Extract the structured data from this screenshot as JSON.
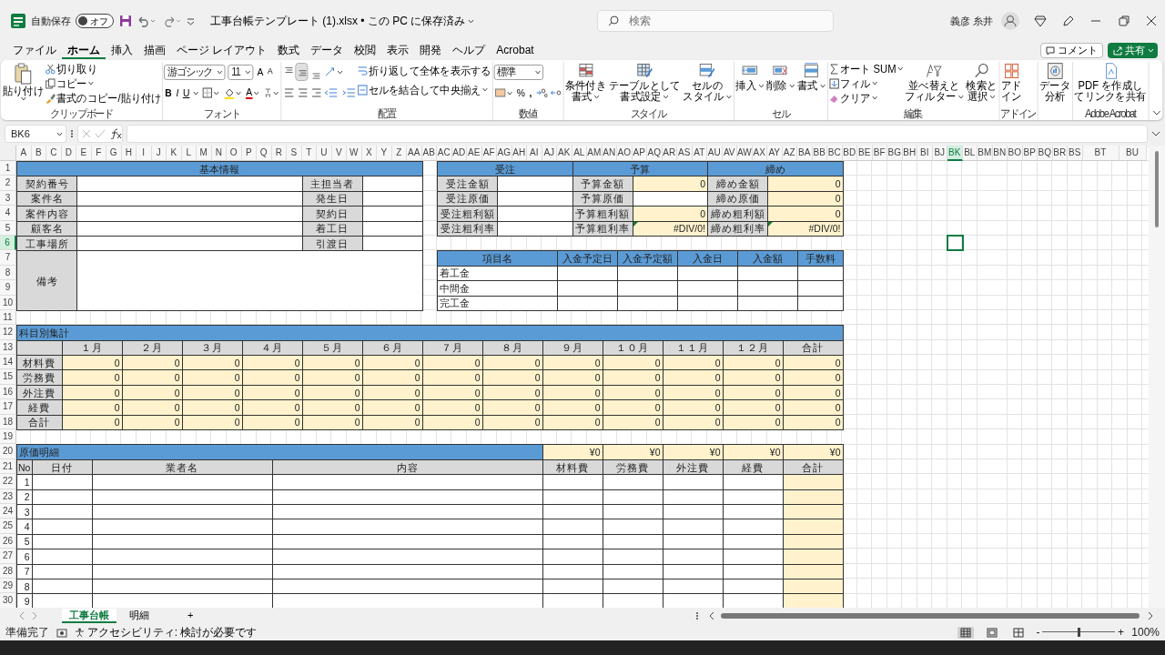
{
  "title_bar": {
    "autosave_label": "自動保存",
    "autosave": {
      "on": false,
      "label": "オフ"
    },
    "document_title": "工事台帳テンプレート (1).xlsx • この PC に保存済み",
    "search": {
      "placeholder": "検索"
    },
    "user_name": "義彦 糸井"
  },
  "menu_tabs": [
    {
      "label": "ファイル",
      "selected": false
    },
    {
      "label": "ホーム",
      "selected": true
    },
    {
      "label": "挿入",
      "selected": false
    },
    {
      "label": "描画",
      "selected": false
    },
    {
      "label": "ページ レイアウト",
      "selected": false
    },
    {
      "label": "数式",
      "selected": false
    },
    {
      "label": "データ",
      "selected": false
    },
    {
      "label": "校閲",
      "selected": false
    },
    {
      "label": "表示",
      "selected": false
    },
    {
      "label": "開発",
      "selected": false
    },
    {
      "label": "ヘルプ",
      "selected": false
    },
    {
      "label": "Acrobat",
      "selected": false
    }
  ],
  "actions": {
    "comment": "コメント",
    "share": "共有"
  },
  "ribbon": [
    {
      "kind": "clipboard",
      "title": "クリップボード",
      "paste": "貼り付け",
      "commands": [
        "切り取り",
        "コピー",
        "書式のコピー/貼り付け"
      ]
    },
    {
      "kind": "font",
      "title": "フォント",
      "font_name": "游ゴシック",
      "font_size": "11",
      "grow": "A",
      "shrink": "A",
      "bold": "B",
      "italic": "I",
      "underline": "U",
      "font_color": "A"
    },
    {
      "kind": "alignment",
      "title": "配置",
      "vertical": [
        {
          "selected": false
        },
        {
          "selected": true
        },
        {
          "selected": false
        }
      ],
      "wrap_text": "折り返して全体を表示する",
      "merge": "セルを結合して中央揃え"
    },
    {
      "kind": "number",
      "title": "数値",
      "format": "標準",
      "percent": "%",
      "comma": ","
    },
    {
      "kind": "large",
      "title": "スタイル",
      "commands": [
        {
          "lines": [
            "条件付き",
            "書式"
          ],
          "dropdown": true
        },
        {
          "lines": [
            "テーブルとして",
            "書式設定"
          ],
          "dropdown": true
        },
        {
          "lines": [
            "セルの",
            "スタイル"
          ],
          "dropdown": true
        }
      ]
    },
    {
      "kind": "large",
      "title": "セル",
      "commands": [
        {
          "lines": [
            "挿入"
          ],
          "dropdown": true
        },
        {
          "lines": [
            "削除"
          ],
          "dropdown": true
        },
        {
          "lines": [
            "書式"
          ],
          "dropdown": true
        }
      ]
    },
    {
      "kind": "editing",
      "title": "編集",
      "small": [
        "オート SUM",
        "フィル",
        "クリア"
      ],
      "commands": [
        {
          "lines": [
            "並べ替えと",
            "フィルター"
          ],
          "dropdown": true
        },
        {
          "lines": [
            "検索と",
            "選択"
          ],
          "dropdown": true
        }
      ]
    },
    {
      "kind": "large",
      "title": "アドイン",
      "commands": [
        {
          "lines": [
            "アド",
            "イン"
          ],
          "dropdown": false
        }
      ]
    },
    {
      "kind": "large",
      "commands": [
        {
          "lines": [
            "データ",
            "分析"
          ],
          "dropdown": false
        }
      ]
    },
    {
      "kind": "large",
      "title": "Adobe Acrobat",
      "commands": [
        {
          "lines": [
            "PDF を作成し",
            "てリンクを共有"
          ],
          "dropdown": false
        }
      ]
    }
  ],
  "formula_bar": {
    "name_box": "BK6"
  },
  "sheet": {
    "columns": [
      {
        "label": "A",
        "selected": false
      },
      {
        "label": "B",
        "selected": false
      },
      {
        "label": "C",
        "selected": false
      },
      {
        "label": "D",
        "selected": false
      },
      {
        "label": "E",
        "selected": false
      },
      {
        "label": "F",
        "selected": false
      },
      {
        "label": "G",
        "selected": false
      },
      {
        "label": "H",
        "selected": false
      },
      {
        "label": "I",
        "selected": false
      },
      {
        "label": "J",
        "selected": false
      },
      {
        "label": "K",
        "selected": false
      },
      {
        "label": "L",
        "selected": false
      },
      {
        "label": "M",
        "selected": false
      },
      {
        "label": "N",
        "selected": false
      },
      {
        "label": "O",
        "selected": false
      },
      {
        "label": "P",
        "selected": false
      },
      {
        "label": "Q",
        "selected": false
      },
      {
        "label": "R",
        "selected": false
      },
      {
        "label": "S",
        "selected": false
      },
      {
        "label": "T",
        "selected": false
      },
      {
        "label": "U",
        "selected": false
      },
      {
        "label": "V",
        "selected": false
      },
      {
        "label": "W",
        "selected": false
      },
      {
        "label": "X",
        "selected": false
      },
      {
        "label": "Y",
        "selected": false
      },
      {
        "label": "Z",
        "selected": false
      },
      {
        "label": "AA",
        "selected": false
      },
      {
        "label": "AB",
        "selected": false
      },
      {
        "label": "AC",
        "selected": false
      },
      {
        "label": "AD",
        "selected": false
      },
      {
        "label": "AE",
        "selected": false
      },
      {
        "label": "AF",
        "selected": false
      },
      {
        "label": "AG",
        "selected": false
      },
      {
        "label": "AH",
        "selected": false
      },
      {
        "label": "AI",
        "selected": false
      },
      {
        "label": "AJ",
        "selected": false
      },
      {
        "label": "AK",
        "selected": false
      },
      {
        "label": "AL",
        "selected": false
      },
      {
        "label": "AM",
        "selected": false
      },
      {
        "label": "AN",
        "selected": false
      },
      {
        "label": "AO",
        "selected": false
      },
      {
        "label": "AP",
        "selected": false
      },
      {
        "label": "AQ",
        "selected": false
      },
      {
        "label": "AR",
        "selected": false
      },
      {
        "label": "AS",
        "selected": false
      },
      {
        "label": "AT",
        "selected": false
      },
      {
        "label": "AU",
        "selected": false
      },
      {
        "label": "AV",
        "selected": false
      },
      {
        "label": "AW",
        "selected": false
      },
      {
        "label": "AX",
        "selected": false
      },
      {
        "label": "AY",
        "selected": false
      },
      {
        "label": "AZ",
        "selected": false
      },
      {
        "label": "BA",
        "selected": false
      },
      {
        "label": "BB",
        "selected": false
      },
      {
        "label": "BC",
        "selected": false
      },
      {
        "label": "BD",
        "selected": false
      },
      {
        "label": "BE",
        "selected": false
      },
      {
        "label": "BF",
        "selected": false
      },
      {
        "label": "BG",
        "selected": false
      },
      {
        "label": "BH",
        "selected": false
      },
      {
        "label": "BI",
        "selected": false
      },
      {
        "label": "BJ",
        "selected": false
      },
      {
        "label": "BK",
        "selected": true
      },
      {
        "label": "BL",
        "selected": false
      },
      {
        "label": "BM",
        "selected": false
      },
      {
        "label": "BN",
        "selected": false
      },
      {
        "label": "BO",
        "selected": false
      },
      {
        "label": "BP",
        "selected": false
      },
      {
        "label": "BQ",
        "selected": false
      },
      {
        "label": "BR",
        "selected": false
      },
      {
        "label": "BS",
        "selected": false
      },
      {
        "label": "BT",
        "selected": false
      },
      {
        "label": "BU",
        "selected": false
      }
    ],
    "rows": [
      {
        "label": "1",
        "selected": false
      },
      {
        "label": "2",
        "selected": false
      },
      {
        "label": "3",
        "selected": false
      },
      {
        "label": "4",
        "selected": false
      },
      {
        "label": "5",
        "selected": false
      },
      {
        "label": "6",
        "selected": true
      },
      {
        "label": "7",
        "selected": false
      },
      {
        "label": "8",
        "selected": false
      },
      {
        "label": "9",
        "selected": false
      },
      {
        "label": "10",
        "selected": false
      },
      {
        "label": "11",
        "selected": false
      },
      {
        "label": "12",
        "selected": false
      },
      {
        "label": "13",
        "selected": false
      },
      {
        "label": "14",
        "selected": false
      },
      {
        "label": "15",
        "selected": false
      },
      {
        "label": "16",
        "selected": false
      },
      {
        "label": "17",
        "selected": false
      },
      {
        "label": "18",
        "selected": false
      },
      {
        "label": "19",
        "selected": false
      },
      {
        "label": "20",
        "selected": false
      },
      {
        "label": "21",
        "selected": false
      },
      {
        "label": "22",
        "selected": false
      },
      {
        "label": "23",
        "selected": false
      },
      {
        "label": "24",
        "selected": false
      },
      {
        "label": "25",
        "selected": false
      },
      {
        "label": "26",
        "selected": false
      },
      {
        "label": "27",
        "selected": false
      },
      {
        "label": "28",
        "selected": false
      },
      {
        "label": "29",
        "selected": false
      },
      {
        "label": "30",
        "selected": false
      }
    ],
    "basic_info": {
      "title": "基本情報",
      "left_labels": [
        "契約番号",
        "案件名",
        "案件内容",
        "顧客名",
        "工事場所"
      ],
      "right_labels": [
        "主担当者",
        "発生日",
        "契約日",
        "着工日",
        "引渡日"
      ],
      "remarks_label": "備考"
    },
    "summary_blocks": [
      {
        "title": "受注",
        "rows": [
          {
            "label": "受注金額",
            "computed": false,
            "error": false
          },
          {
            "label": "受注原価",
            "computed": false,
            "error": false
          },
          {
            "label": "受注粗利額",
            "computed": false,
            "error": false
          },
          {
            "label": "受注粗利率",
            "computed": false,
            "error": false
          }
        ]
      },
      {
        "title": "予算",
        "rows": [
          {
            "label": "予算金額",
            "value": "0",
            "computed": true,
            "error": false
          },
          {
            "label": "予算原価",
            "computed": false,
            "error": false
          },
          {
            "label": "予算粗利額",
            "value": "0",
            "computed": true,
            "error": false
          },
          {
            "label": "予算粗利率",
            "value": "#DIV/0!",
            "computed": true,
            "error": true
          }
        ]
      },
      {
        "title": "締め",
        "rows": [
          {
            "label": "締め金額",
            "value": "0",
            "computed": true,
            "error": false
          },
          {
            "label": "締め原価",
            "value": "0",
            "computed": true,
            "error": false
          },
          {
            "label": "締め粗利額",
            "value": "0",
            "computed": true,
            "error": false
          },
          {
            "label": "締め粗利率",
            "value": "#DIV/0!",
            "computed": true,
            "error": true
          }
        ]
      }
    ],
    "payments": {
      "columns": [
        "項目名",
        "入金予定日",
        "入金予定額",
        "入金日",
        "入金額",
        "手数料"
      ],
      "rows": [
        "着工金",
        "中間金",
        "完工金"
      ]
    },
    "cost_summary": {
      "title": "科目別集計",
      "columns": [
        "１月",
        "２月",
        "３月",
        "４月",
        "５月",
        "６月",
        "７月",
        "８月",
        "９月",
        "１０月",
        "１１月",
        "１２月",
        "合計"
      ],
      "rows": [
        {
          "label": "材料費",
          "values": [
            "0",
            "0",
            "0",
            "0",
            "0",
            "0",
            "0",
            "0",
            "0",
            "0",
            "0",
            "0",
            "0"
          ]
        },
        {
          "label": "労務費",
          "values": [
            "0",
            "0",
            "0",
            "0",
            "0",
            "0",
            "0",
            "0",
            "0",
            "0",
            "0",
            "0",
            "0"
          ]
        },
        {
          "label": "外注費",
          "values": [
            "0",
            "0",
            "0",
            "0",
            "0",
            "0",
            "0",
            "0",
            "0",
            "0",
            "0",
            "0",
            "0"
          ]
        },
        {
          "label": "経費",
          "values": [
            "0",
            "0",
            "0",
            "0",
            "0",
            "0",
            "0",
            "0",
            "0",
            "0",
            "0",
            "0",
            "0"
          ]
        },
        {
          "label": "合計",
          "values": [
            "0",
            "0",
            "0",
            "0",
            "0",
            "0",
            "0",
            "0",
            "0",
            "0",
            "0",
            "0",
            "0"
          ]
        }
      ]
    },
    "cost_details": {
      "title": "原価明細",
      "totals": [
        "¥0",
        "¥0",
        "¥0",
        "¥0",
        "¥0"
      ],
      "columns": [
        "No",
        "日付",
        "業者名",
        "内容",
        "材料費",
        "労務費",
        "外注費",
        "経費",
        "合計"
      ],
      "rows": [
        "1",
        "2",
        "3",
        "4",
        "5",
        "6",
        "7",
        "8",
        "9"
      ]
    }
  },
  "sheet_tabs": [
    {
      "label": "工事台帳",
      "selected": true
    },
    {
      "label": "明細",
      "selected": false
    }
  ],
  "add_sheet": "+",
  "status_bar": {
    "ready": "準備完了",
    "accessibility": "アクセシビリティ: 検討が必要です",
    "views": [
      {
        "selected": true
      },
      {
        "selected": false
      },
      {
        "selected": false
      }
    ],
    "zoom_minus": "-",
    "zoom_plus": "+",
    "zoom": {
      "level": 0.5
    },
    "zoom_label": "100%"
  }
}
